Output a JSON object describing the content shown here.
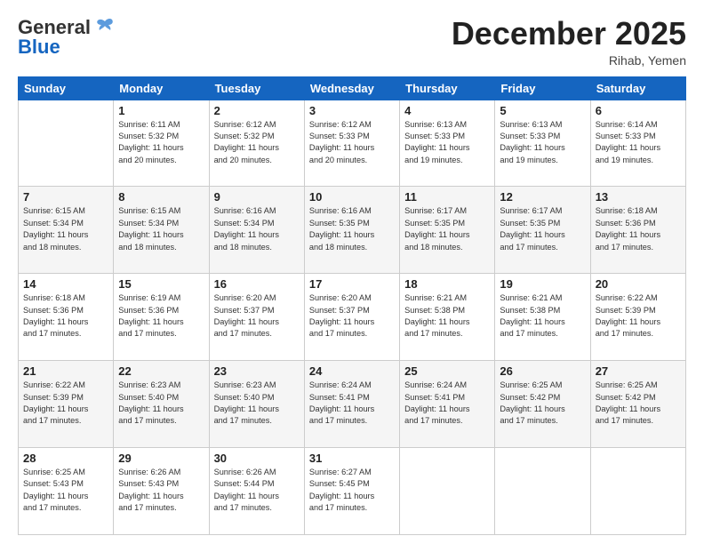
{
  "header": {
    "logo_general": "General",
    "logo_blue": "Blue",
    "month_title": "December 2025",
    "location": "Rihab, Yemen"
  },
  "days_of_week": [
    "Sunday",
    "Monday",
    "Tuesday",
    "Wednesday",
    "Thursday",
    "Friday",
    "Saturday"
  ],
  "weeks": [
    [
      {
        "day": "",
        "info": ""
      },
      {
        "day": "1",
        "info": "Sunrise: 6:11 AM\nSunset: 5:32 PM\nDaylight: 11 hours\nand 20 minutes."
      },
      {
        "day": "2",
        "info": "Sunrise: 6:12 AM\nSunset: 5:32 PM\nDaylight: 11 hours\nand 20 minutes."
      },
      {
        "day": "3",
        "info": "Sunrise: 6:12 AM\nSunset: 5:33 PM\nDaylight: 11 hours\nand 20 minutes."
      },
      {
        "day": "4",
        "info": "Sunrise: 6:13 AM\nSunset: 5:33 PM\nDaylight: 11 hours\nand 19 minutes."
      },
      {
        "day": "5",
        "info": "Sunrise: 6:13 AM\nSunset: 5:33 PM\nDaylight: 11 hours\nand 19 minutes."
      },
      {
        "day": "6",
        "info": "Sunrise: 6:14 AM\nSunset: 5:33 PM\nDaylight: 11 hours\nand 19 minutes."
      }
    ],
    [
      {
        "day": "7",
        "info": "Sunrise: 6:15 AM\nSunset: 5:34 PM\nDaylight: 11 hours\nand 18 minutes."
      },
      {
        "day": "8",
        "info": "Sunrise: 6:15 AM\nSunset: 5:34 PM\nDaylight: 11 hours\nand 18 minutes."
      },
      {
        "day": "9",
        "info": "Sunrise: 6:16 AM\nSunset: 5:34 PM\nDaylight: 11 hours\nand 18 minutes."
      },
      {
        "day": "10",
        "info": "Sunrise: 6:16 AM\nSunset: 5:35 PM\nDaylight: 11 hours\nand 18 minutes."
      },
      {
        "day": "11",
        "info": "Sunrise: 6:17 AM\nSunset: 5:35 PM\nDaylight: 11 hours\nand 18 minutes."
      },
      {
        "day": "12",
        "info": "Sunrise: 6:17 AM\nSunset: 5:35 PM\nDaylight: 11 hours\nand 17 minutes."
      },
      {
        "day": "13",
        "info": "Sunrise: 6:18 AM\nSunset: 5:36 PM\nDaylight: 11 hours\nand 17 minutes."
      }
    ],
    [
      {
        "day": "14",
        "info": "Sunrise: 6:18 AM\nSunset: 5:36 PM\nDaylight: 11 hours\nand 17 minutes."
      },
      {
        "day": "15",
        "info": "Sunrise: 6:19 AM\nSunset: 5:36 PM\nDaylight: 11 hours\nand 17 minutes."
      },
      {
        "day": "16",
        "info": "Sunrise: 6:20 AM\nSunset: 5:37 PM\nDaylight: 11 hours\nand 17 minutes."
      },
      {
        "day": "17",
        "info": "Sunrise: 6:20 AM\nSunset: 5:37 PM\nDaylight: 11 hours\nand 17 minutes."
      },
      {
        "day": "18",
        "info": "Sunrise: 6:21 AM\nSunset: 5:38 PM\nDaylight: 11 hours\nand 17 minutes."
      },
      {
        "day": "19",
        "info": "Sunrise: 6:21 AM\nSunset: 5:38 PM\nDaylight: 11 hours\nand 17 minutes."
      },
      {
        "day": "20",
        "info": "Sunrise: 6:22 AM\nSunset: 5:39 PM\nDaylight: 11 hours\nand 17 minutes."
      }
    ],
    [
      {
        "day": "21",
        "info": "Sunrise: 6:22 AM\nSunset: 5:39 PM\nDaylight: 11 hours\nand 17 minutes."
      },
      {
        "day": "22",
        "info": "Sunrise: 6:23 AM\nSunset: 5:40 PM\nDaylight: 11 hours\nand 17 minutes."
      },
      {
        "day": "23",
        "info": "Sunrise: 6:23 AM\nSunset: 5:40 PM\nDaylight: 11 hours\nand 17 minutes."
      },
      {
        "day": "24",
        "info": "Sunrise: 6:24 AM\nSunset: 5:41 PM\nDaylight: 11 hours\nand 17 minutes."
      },
      {
        "day": "25",
        "info": "Sunrise: 6:24 AM\nSunset: 5:41 PM\nDaylight: 11 hours\nand 17 minutes."
      },
      {
        "day": "26",
        "info": "Sunrise: 6:25 AM\nSunset: 5:42 PM\nDaylight: 11 hours\nand 17 minutes."
      },
      {
        "day": "27",
        "info": "Sunrise: 6:25 AM\nSunset: 5:42 PM\nDaylight: 11 hours\nand 17 minutes."
      }
    ],
    [
      {
        "day": "28",
        "info": "Sunrise: 6:25 AM\nSunset: 5:43 PM\nDaylight: 11 hours\nand 17 minutes."
      },
      {
        "day": "29",
        "info": "Sunrise: 6:26 AM\nSunset: 5:43 PM\nDaylight: 11 hours\nand 17 minutes."
      },
      {
        "day": "30",
        "info": "Sunrise: 6:26 AM\nSunset: 5:44 PM\nDaylight: 11 hours\nand 17 minutes."
      },
      {
        "day": "31",
        "info": "Sunrise: 6:27 AM\nSunset: 5:45 PM\nDaylight: 11 hours\nand 17 minutes."
      },
      {
        "day": "",
        "info": ""
      },
      {
        "day": "",
        "info": ""
      },
      {
        "day": "",
        "info": ""
      }
    ]
  ]
}
